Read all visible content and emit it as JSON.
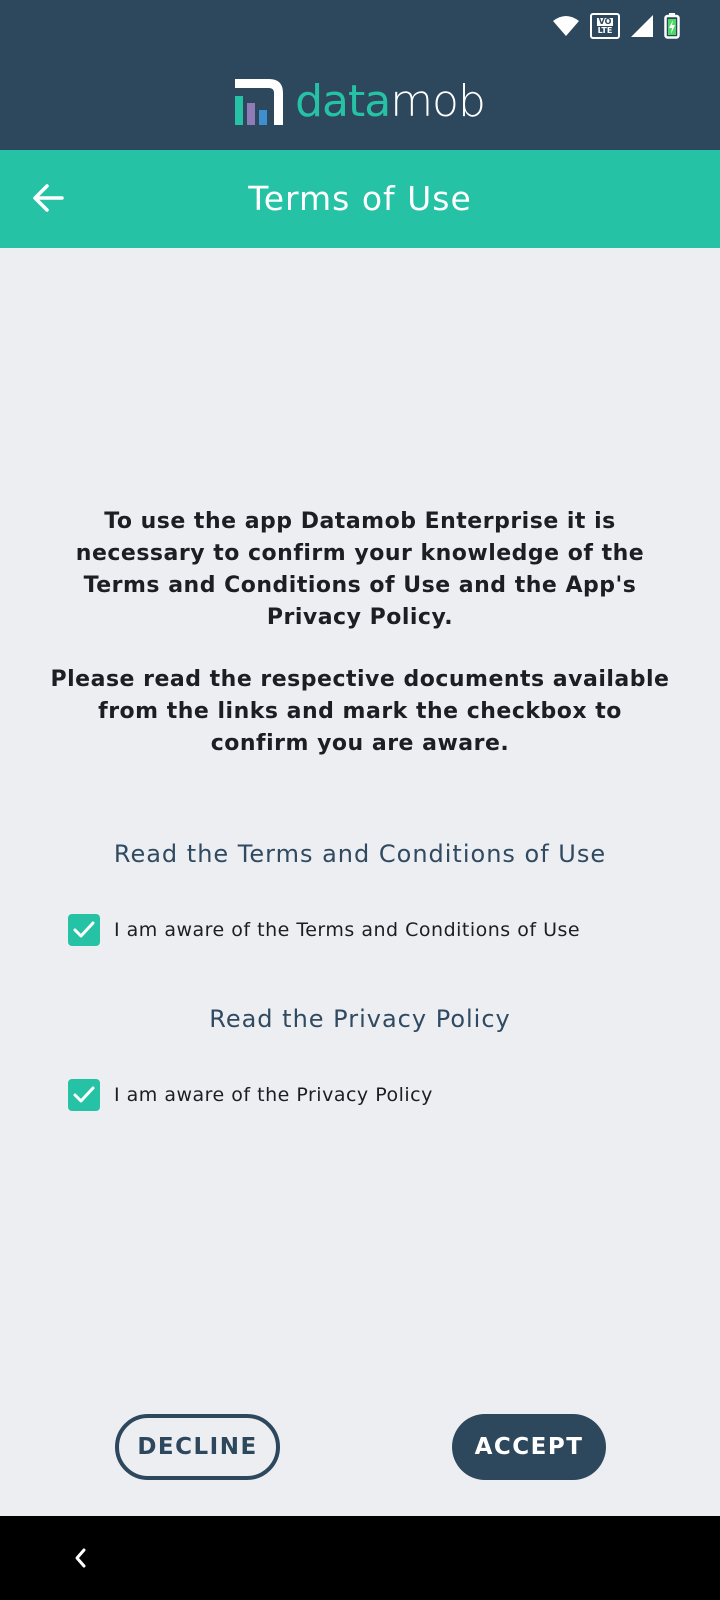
{
  "status_bar": {
    "icons": [
      "wifi-icon",
      "volte-icon",
      "signal-icon",
      "battery-icon"
    ],
    "volte_top": "VO",
    "volte_bottom": "LTE"
  },
  "brand": {
    "logo_part1": "data",
    "logo_part2": "mob",
    "colors": {
      "primary_dark": "#2d475c",
      "accent": "#26c2a5",
      "logo_bars": [
        "#26c2a5",
        "#8f7bb5",
        "#3d8fd0"
      ]
    }
  },
  "toolbar": {
    "title": "Terms of Use",
    "back_icon": "arrow-left-icon"
  },
  "intro": {
    "paragraph1": "To use the app Datamob Enterprise it is necessary to confirm your knowledge of the Terms and Conditions of Use and the App's Privacy Policy.",
    "paragraph2": "Please read the respective documents available from the links and mark the checkbox to confirm you are aware."
  },
  "terms": {
    "link_text": "Read the Terms and Conditions of Use",
    "checkbox_label": "I am aware of the Terms and Conditions of Use",
    "checked": true
  },
  "privacy": {
    "link_text": "Read the Privacy Policy",
    "checkbox_label": "I am aware of the Privacy Policy",
    "checked": true
  },
  "actions": {
    "decline_label": "DECLINE",
    "accept_label": "ACCEPT"
  },
  "navbar": {
    "back_icon": "chevron-left-icon"
  }
}
